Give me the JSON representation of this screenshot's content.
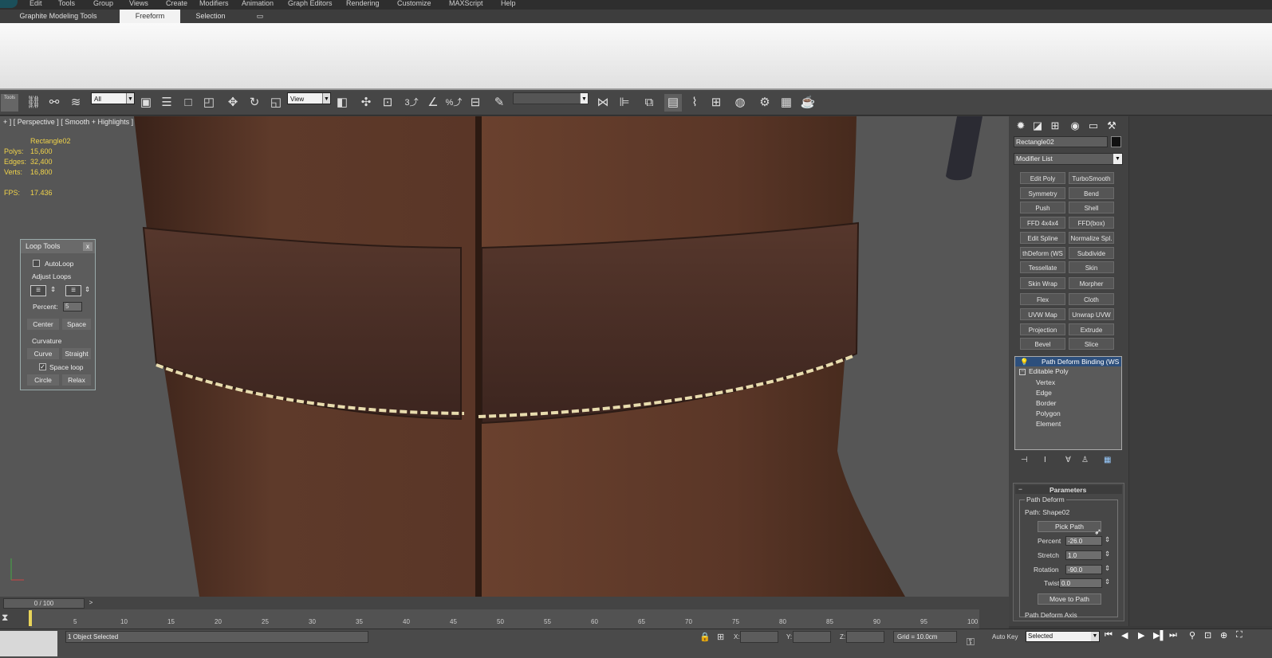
{
  "menu": [
    "Edit",
    "Tools",
    "Group",
    "Views",
    "Create",
    "Modifiers",
    "Animation",
    "Graph Editors",
    "Rendering",
    "Customize",
    "MAXScript",
    "Help"
  ],
  "ribbon_tabs": [
    "Graphite Modeling Tools",
    "Freeform",
    "Selection"
  ],
  "toolbar": {
    "filter": "All",
    "ref_coord": "View",
    "tools_label": "Tools",
    "snap_3": "3",
    "percent": "%"
  },
  "viewport": {
    "label": "+ ] [ Perspective ] [ Smooth + Highlights ]",
    "object": "Rectangle02",
    "stats": [
      {
        "k": "Polys:",
        "v": "15,600"
      },
      {
        "k": "Edges:",
        "v": "32,400"
      },
      {
        "k": "Verts:",
        "v": "16,800"
      }
    ],
    "fps_k": "FPS:",
    "fps_v": "17.436"
  },
  "loop_tools": {
    "title": "Loop Tools",
    "close": "x",
    "autoloop": "AutoLoop",
    "adjust": "Adjust Loops",
    "percent_label": "Percent:",
    "percent_value": "5",
    "center": "Center",
    "space": "Space",
    "curvature": "Curvature",
    "curve": "Curve",
    "straight": "Straight",
    "space_loop": "Space loop",
    "circle": "Circle",
    "relax": "Relax"
  },
  "command_panel": {
    "object_name": "Rectangle02",
    "modifier_list": "Modifier List",
    "modifiers": [
      [
        "Edit Poly",
        "TurboSmooth"
      ],
      [
        "Symmetry",
        "Bend"
      ],
      [
        "Push",
        "Shell"
      ],
      [
        "FFD 4x4x4",
        "FFD(box)"
      ],
      [
        "Edit Spline",
        "Normalize Spl."
      ],
      [
        "thDeform (WS",
        "Subdivide"
      ],
      [
        "Tessellate",
        "Skin"
      ],
      [
        "Skin Wrap",
        "Morpher"
      ],
      [
        "Flex",
        "Cloth"
      ],
      [
        "UVW Map",
        "Unwrap UVW"
      ],
      [
        "Projection",
        "Extrude"
      ],
      [
        "Bevel",
        "Slice"
      ]
    ],
    "stack_top": "Path Deform Binding (WS",
    "stack_base": "Editable Poly",
    "sub_objects": [
      "Vertex",
      "Edge",
      "Border",
      "Polygon",
      "Element"
    ],
    "params": {
      "title": "Parameters",
      "group": "Path Deform",
      "path": "Path: Shape02",
      "pick": "Pick Path",
      "fields": [
        {
          "label": "Percent",
          "value": "-26.0"
        },
        {
          "label": "Stretch",
          "value": "1.0"
        },
        {
          "label": "Rotation",
          "value": "-90.0"
        },
        {
          "label": "Twist",
          "value": "0.0"
        }
      ],
      "move": "Move to Path",
      "axis": "Path Deform Axis"
    }
  },
  "timeline": {
    "frame": "0 / 100",
    "ticks": [
      "5",
      "10",
      "15",
      "20",
      "25",
      "30",
      "35",
      "40",
      "45",
      "50",
      "55",
      "60",
      "65",
      "70",
      "75",
      "80",
      "85",
      "90",
      "95",
      "100"
    ]
  },
  "status": {
    "selected": "1 Object Selected",
    "x": "X:",
    "y": "Y:",
    "z": "Z:",
    "grid": "Grid = 10.0cm",
    "autokey": "Auto Key",
    "selected_dd": "Selected"
  },
  "colors": {
    "leather": "#5a3627",
    "belt": "#4a2e26",
    "stitch": "#e8dcae",
    "accent": "#f0d34a"
  }
}
